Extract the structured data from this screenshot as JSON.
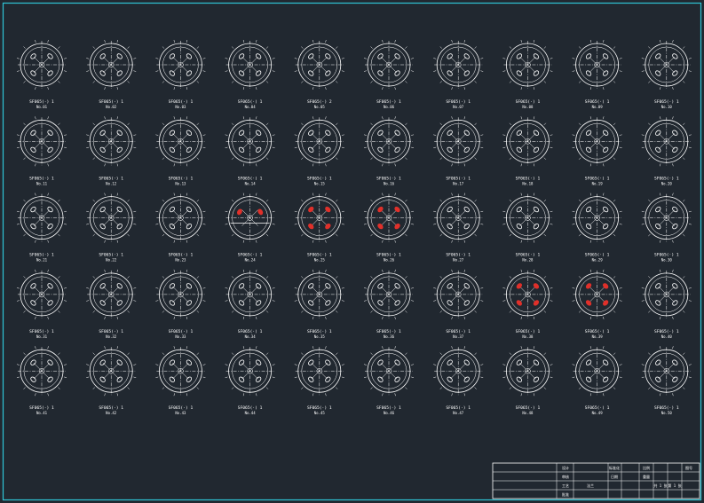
{
  "drawing": {
    "frame_color": "#2ec4d6",
    "line_color": "#ffffff",
    "highlight_color": "#e0302a",
    "grid": {
      "rows": 5,
      "cols": 10
    },
    "flanges": [
      {
        "name": "SF065(·) 1",
        "sub": "No.01",
        "holes": 4
      },
      {
        "name": "SF065(·) 1",
        "sub": "No.02",
        "holes": 4
      },
      {
        "name": "SF065(·) 1",
        "sub": "No.03",
        "holes": 4
      },
      {
        "name": "SF065(·) 1",
        "sub": "No.04",
        "holes": 4
      },
      {
        "name": "SF065(·) 2",
        "sub": "No.05",
        "holes": 4
      },
      {
        "name": "SF065(·) 1",
        "sub": "No.06",
        "holes": 4
      },
      {
        "name": "SF065(·) 1",
        "sub": "No.07",
        "holes": 4
      },
      {
        "name": "SF065(·) 1",
        "sub": "No.08",
        "holes": 4
      },
      {
        "name": "SF065(·) 1",
        "sub": "No.09",
        "holes": 4
      },
      {
        "name": "SF065(·) 1",
        "sub": "No.10",
        "holes": 4
      },
      {
        "name": "SF065(·) 1",
        "sub": "No.11",
        "holes": 4
      },
      {
        "name": "SF065(·) 1",
        "sub": "No.12",
        "holes": 4
      },
      {
        "name": "SF065(·) 1",
        "sub": "No.13",
        "holes": 4
      },
      {
        "name": "SF065(·) 1",
        "sub": "No.14",
        "holes": 4
      },
      {
        "name": "SF065(·) 1",
        "sub": "No.15",
        "holes": 4
      },
      {
        "name": "SF065(·) 1",
        "sub": "No.16",
        "holes": 4
      },
      {
        "name": "SF065(·) 1",
        "sub": "No.17",
        "holes": 4
      },
      {
        "name": "SF065(·) 1",
        "sub": "No.18",
        "holes": 4
      },
      {
        "name": "SF065(·) 1",
        "sub": "No.19",
        "holes": 4
      },
      {
        "name": "SF065(·) 1",
        "sub": "No.20",
        "holes": 4
      },
      {
        "name": "SF065(·) 1",
        "sub": "No.21",
        "holes": 4
      },
      {
        "name": "SF065(·) 1",
        "sub": "No.22",
        "holes": 4
      },
      {
        "name": "SF065(·) 1",
        "sub": "No.23",
        "holes": 4
      },
      {
        "name": "SF065(·) 1",
        "sub": "No.24",
        "holes": 2,
        "hl": [
          0,
          1
        ],
        "bottom": true
      },
      {
        "name": "SF065(·) 1",
        "sub": "No.25",
        "holes": 4,
        "hl": [
          0,
          1,
          2,
          3
        ]
      },
      {
        "name": "SF065(·) 1",
        "sub": "No.26",
        "holes": 4,
        "hl": [
          0,
          1,
          2,
          3
        ]
      },
      {
        "name": "SF065(·) 1",
        "sub": "No.27",
        "holes": 4
      },
      {
        "name": "SF065(·) 1",
        "sub": "No.28",
        "holes": 4
      },
      {
        "name": "SF065(·) 1",
        "sub": "No.29",
        "holes": 4
      },
      {
        "name": "SF065(·) 1",
        "sub": "No.30",
        "holes": 4
      },
      {
        "name": "SF065(·) 1",
        "sub": "No.31",
        "holes": 4
      },
      {
        "name": "SF065(·) 1",
        "sub": "No.32",
        "holes": 4
      },
      {
        "name": "SF065(·) 1",
        "sub": "No.33",
        "holes": 4
      },
      {
        "name": "SF065(·) 1",
        "sub": "No.34",
        "holes": 4
      },
      {
        "name": "SF065(·) 1",
        "sub": "No.35",
        "holes": 4
      },
      {
        "name": "SF065(·) 1",
        "sub": "No.36",
        "holes": 4
      },
      {
        "name": "SF065(·) 1",
        "sub": "No.37",
        "holes": 4
      },
      {
        "name": "SF065(·) 1",
        "sub": "No.38",
        "holes": 4,
        "hl": [
          0,
          1,
          2,
          3
        ]
      },
      {
        "name": "SF065(·) 1",
        "sub": "No.39",
        "holes": 4,
        "hl": [
          0,
          1,
          2,
          3
        ]
      },
      {
        "name": "SF065(·) 1",
        "sub": "No.40",
        "holes": 4
      },
      {
        "name": "SF065(·) 1",
        "sub": "No.41",
        "holes": 4
      },
      {
        "name": "SF065(·) 1",
        "sub": "No.42",
        "holes": 4
      },
      {
        "name": "SF065(·) 1",
        "sub": "No.43",
        "holes": 4
      },
      {
        "name": "SF065(·) 1",
        "sub": "No.44",
        "holes": 4
      },
      {
        "name": "SF065(·) 1",
        "sub": "No.45",
        "holes": 4
      },
      {
        "name": "SF065(·) 1",
        "sub": "No.46",
        "holes": 4
      },
      {
        "name": "SF065(·) 1",
        "sub": "No.47",
        "holes": 4
      },
      {
        "name": "SF065(·) 1",
        "sub": "No.48",
        "holes": 4
      },
      {
        "name": "SF065(·) 1",
        "sub": "No.49",
        "holes": 4
      },
      {
        "name": "SF065(·) 1",
        "sub": "No.50",
        "holes": 4
      }
    ]
  },
  "title_block": {
    "cells": [
      "设计",
      "审核",
      "工艺",
      "批准",
      "标准化",
      "日期",
      "比例",
      "重量",
      "共 1 张",
      "第 1 张",
      "法兰",
      "图号"
    ]
  }
}
